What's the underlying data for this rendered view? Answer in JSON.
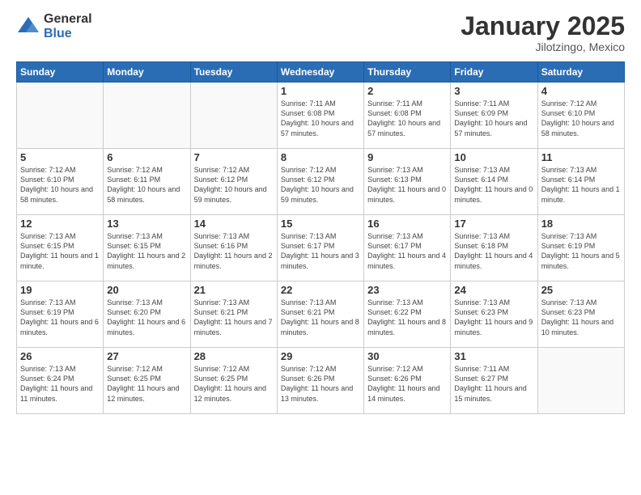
{
  "logo": {
    "general": "General",
    "blue": "Blue"
  },
  "header": {
    "month_year": "January 2025",
    "location": "Jilotzingo, Mexico"
  },
  "weekdays": [
    "Sunday",
    "Monday",
    "Tuesday",
    "Wednesday",
    "Thursday",
    "Friday",
    "Saturday"
  ],
  "weeks": [
    [
      {
        "day": "",
        "info": ""
      },
      {
        "day": "",
        "info": ""
      },
      {
        "day": "",
        "info": ""
      },
      {
        "day": "1",
        "info": "Sunrise: 7:11 AM\nSunset: 6:08 PM\nDaylight: 10 hours and 57 minutes."
      },
      {
        "day": "2",
        "info": "Sunrise: 7:11 AM\nSunset: 6:08 PM\nDaylight: 10 hours and 57 minutes."
      },
      {
        "day": "3",
        "info": "Sunrise: 7:11 AM\nSunset: 6:09 PM\nDaylight: 10 hours and 57 minutes."
      },
      {
        "day": "4",
        "info": "Sunrise: 7:12 AM\nSunset: 6:10 PM\nDaylight: 10 hours and 58 minutes."
      }
    ],
    [
      {
        "day": "5",
        "info": "Sunrise: 7:12 AM\nSunset: 6:10 PM\nDaylight: 10 hours and 58 minutes."
      },
      {
        "day": "6",
        "info": "Sunrise: 7:12 AM\nSunset: 6:11 PM\nDaylight: 10 hours and 58 minutes."
      },
      {
        "day": "7",
        "info": "Sunrise: 7:12 AM\nSunset: 6:12 PM\nDaylight: 10 hours and 59 minutes."
      },
      {
        "day": "8",
        "info": "Sunrise: 7:12 AM\nSunset: 6:12 PM\nDaylight: 10 hours and 59 minutes."
      },
      {
        "day": "9",
        "info": "Sunrise: 7:13 AM\nSunset: 6:13 PM\nDaylight: 11 hours and 0 minutes."
      },
      {
        "day": "10",
        "info": "Sunrise: 7:13 AM\nSunset: 6:14 PM\nDaylight: 11 hours and 0 minutes."
      },
      {
        "day": "11",
        "info": "Sunrise: 7:13 AM\nSunset: 6:14 PM\nDaylight: 11 hours and 1 minute."
      }
    ],
    [
      {
        "day": "12",
        "info": "Sunrise: 7:13 AM\nSunset: 6:15 PM\nDaylight: 11 hours and 1 minute."
      },
      {
        "day": "13",
        "info": "Sunrise: 7:13 AM\nSunset: 6:15 PM\nDaylight: 11 hours and 2 minutes."
      },
      {
        "day": "14",
        "info": "Sunrise: 7:13 AM\nSunset: 6:16 PM\nDaylight: 11 hours and 2 minutes."
      },
      {
        "day": "15",
        "info": "Sunrise: 7:13 AM\nSunset: 6:17 PM\nDaylight: 11 hours and 3 minutes."
      },
      {
        "day": "16",
        "info": "Sunrise: 7:13 AM\nSunset: 6:17 PM\nDaylight: 11 hours and 4 minutes."
      },
      {
        "day": "17",
        "info": "Sunrise: 7:13 AM\nSunset: 6:18 PM\nDaylight: 11 hours and 4 minutes."
      },
      {
        "day": "18",
        "info": "Sunrise: 7:13 AM\nSunset: 6:19 PM\nDaylight: 11 hours and 5 minutes."
      }
    ],
    [
      {
        "day": "19",
        "info": "Sunrise: 7:13 AM\nSunset: 6:19 PM\nDaylight: 11 hours and 6 minutes."
      },
      {
        "day": "20",
        "info": "Sunrise: 7:13 AM\nSunset: 6:20 PM\nDaylight: 11 hours and 6 minutes."
      },
      {
        "day": "21",
        "info": "Sunrise: 7:13 AM\nSunset: 6:21 PM\nDaylight: 11 hours and 7 minutes."
      },
      {
        "day": "22",
        "info": "Sunrise: 7:13 AM\nSunset: 6:21 PM\nDaylight: 11 hours and 8 minutes."
      },
      {
        "day": "23",
        "info": "Sunrise: 7:13 AM\nSunset: 6:22 PM\nDaylight: 11 hours and 8 minutes."
      },
      {
        "day": "24",
        "info": "Sunrise: 7:13 AM\nSunset: 6:23 PM\nDaylight: 11 hours and 9 minutes."
      },
      {
        "day": "25",
        "info": "Sunrise: 7:13 AM\nSunset: 6:23 PM\nDaylight: 11 hours and 10 minutes."
      }
    ],
    [
      {
        "day": "26",
        "info": "Sunrise: 7:13 AM\nSunset: 6:24 PM\nDaylight: 11 hours and 11 minutes."
      },
      {
        "day": "27",
        "info": "Sunrise: 7:12 AM\nSunset: 6:25 PM\nDaylight: 11 hours and 12 minutes."
      },
      {
        "day": "28",
        "info": "Sunrise: 7:12 AM\nSunset: 6:25 PM\nDaylight: 11 hours and 12 minutes."
      },
      {
        "day": "29",
        "info": "Sunrise: 7:12 AM\nSunset: 6:26 PM\nDaylight: 11 hours and 13 minutes."
      },
      {
        "day": "30",
        "info": "Sunrise: 7:12 AM\nSunset: 6:26 PM\nDaylight: 11 hours and 14 minutes."
      },
      {
        "day": "31",
        "info": "Sunrise: 7:11 AM\nSunset: 6:27 PM\nDaylight: 11 hours and 15 minutes."
      },
      {
        "day": "",
        "info": ""
      }
    ]
  ]
}
